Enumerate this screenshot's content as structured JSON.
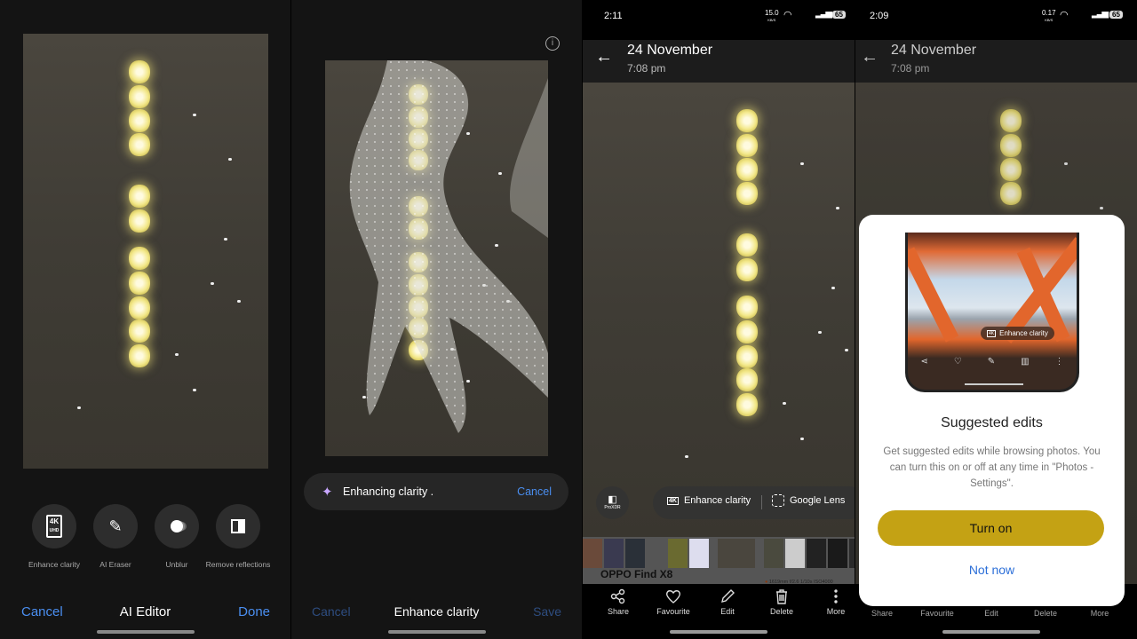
{
  "panel1": {
    "tools": [
      {
        "icon": "4k-uhd-icon",
        "label": "Enhance clarity"
      },
      {
        "icon": "ai-eraser-icon",
        "label": "AI Eraser"
      },
      {
        "icon": "unblur-icon",
        "label": "Unblur"
      },
      {
        "icon": "remove-reflections-icon",
        "label": "Remove reflections"
      }
    ],
    "cancel": "Cancel",
    "title": "AI Editor",
    "done": "Done"
  },
  "panel2": {
    "progress_text": "Enhancing clarity .",
    "progress_cancel": "Cancel",
    "cancel": "Cancel",
    "title": "Enhance clarity",
    "save": "Save"
  },
  "panel3": {
    "status": {
      "time": "2:11",
      "speed": "15.0",
      "speed_unit": "KB/S",
      "battery": "65"
    },
    "header": {
      "date": "24 November",
      "time": "7:08 pm"
    },
    "proxdr": "ProXDR",
    "chips": {
      "enhance": "Enhance clarity",
      "lens": "Google Lens"
    },
    "device": "OPPO Find X8",
    "exif": "1619mm f/2.6 1/10s ISO4000",
    "actions": [
      "Share",
      "Favourite",
      "Edit",
      "Delete",
      "More"
    ]
  },
  "panel4": {
    "status": {
      "time": "2:09",
      "speed": "0.17",
      "speed_unit": "KB/S",
      "battery": "65"
    },
    "header": {
      "date": "24 November",
      "time": "7:08 pm"
    },
    "card": {
      "preview_chip": "Enhance clarity",
      "title": "Suggested edits",
      "body": "Get suggested edits while browsing photos. You can turn this on or off at any time in \"Photos - Settings\".",
      "turn_on": "Turn on",
      "not_now": "Not now"
    },
    "actions": [
      "Share",
      "Favourite",
      "Edit",
      "Delete",
      "More"
    ]
  },
  "colors": {
    "accent_blue": "#4a8ef0",
    "turn_on_button": "#c4a214"
  }
}
